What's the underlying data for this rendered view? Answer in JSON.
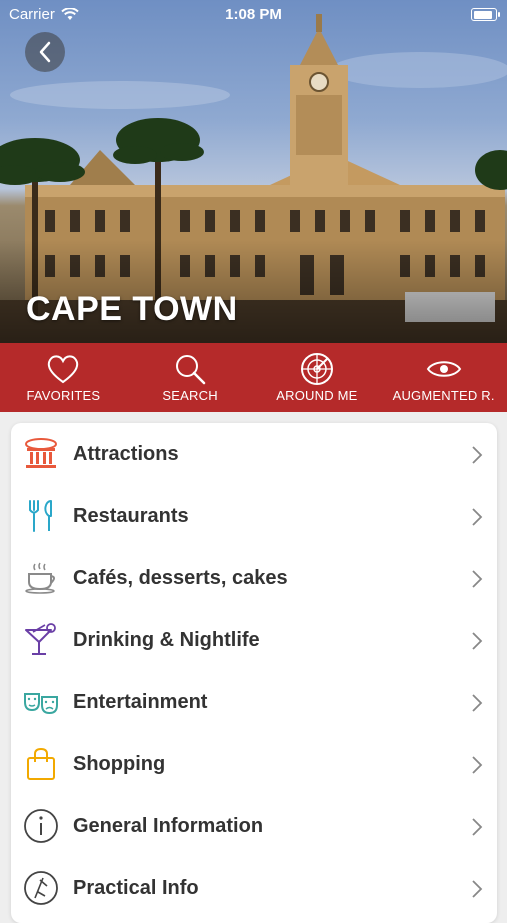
{
  "status": {
    "carrier": "Carrier",
    "time": "1:08 PM"
  },
  "hero": {
    "title": "CAPE TOWN"
  },
  "toolbar": {
    "items": [
      {
        "label": "FAVORITES",
        "icon": "heart-icon"
      },
      {
        "label": "SEARCH",
        "icon": "search-icon"
      },
      {
        "label": "AROUND ME",
        "icon": "radar-icon"
      },
      {
        "label": "AUGMENTED R.",
        "icon": "eye-icon"
      }
    ]
  },
  "menu": {
    "items": [
      {
        "label": "Attractions",
        "icon": "museum-icon",
        "color": "#e8593c"
      },
      {
        "label": "Restaurants",
        "icon": "fork-knife-icon",
        "color": "#2aa7c9"
      },
      {
        "label": "Cafés, desserts, cakes",
        "icon": "coffee-cup-icon",
        "color": "#8a8a8a"
      },
      {
        "label": "Drinking & Nightlife",
        "icon": "cocktail-icon",
        "color": "#6a3fa6"
      },
      {
        "label": "Entertainment",
        "icon": "theater-masks-icon",
        "color": "#3aa7a0"
      },
      {
        "label": "Shopping",
        "icon": "shopping-bag-icon",
        "color": "#f2a900"
      },
      {
        "label": "General Information",
        "icon": "info-icon",
        "color": "#444444"
      },
      {
        "label": "Practical Info",
        "icon": "practical-info-icon",
        "color": "#444444"
      }
    ]
  },
  "colors": {
    "toolbar": "#b52a2a"
  }
}
